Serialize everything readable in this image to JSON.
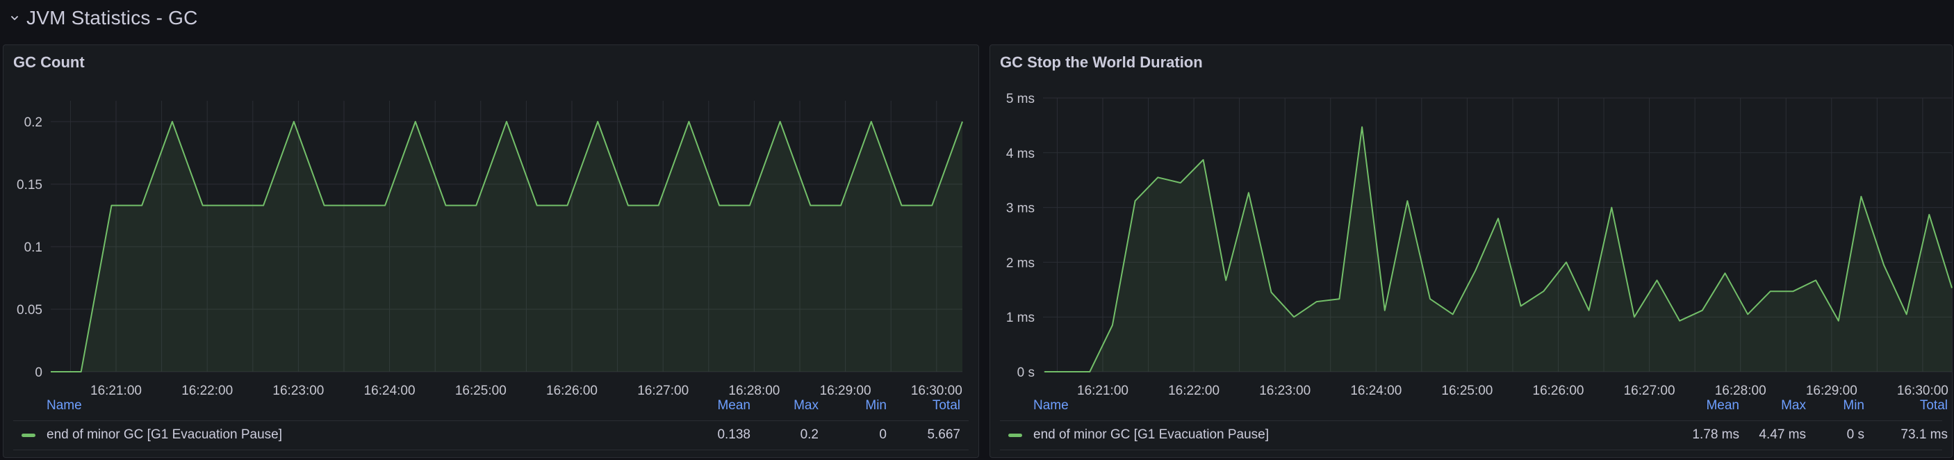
{
  "row": {
    "title": "JVM Statistics - GC"
  },
  "colors": {
    "series": "#73bf69",
    "grid": "#2b2e35",
    "axis_text": "#c7c7d1",
    "legend_header": "#6e9fff"
  },
  "legend_headers": {
    "name": "Name",
    "mean": "Mean",
    "max": "Max",
    "min": "Min",
    "total": "Total"
  },
  "panels": [
    {
      "title": "GC Count",
      "legend": {
        "name": "end of minor GC [G1 Evacuation Pause]",
        "mean": "0.138",
        "max": "0.2",
        "min": "0",
        "total": "5.667"
      },
      "chart_data": {
        "type": "area",
        "ylim": [
          0,
          0.2
        ],
        "yticks": [
          0,
          0.05,
          0.1,
          0.15,
          0.2
        ],
        "ytick_labels": [
          "0",
          "0.05",
          "0.1",
          "0.15",
          "0.2"
        ],
        "xtick_labels": [
          "16:21:00",
          "16:22:00",
          "16:23:00",
          "16:24:00",
          "16:25:00",
          "16:26:00",
          "16:27:00",
          "16:28:00",
          "16:29:00",
          "16:30:00"
        ],
        "x_minutes": [
          -0.75,
          -0.25,
          0,
          0.75,
          1,
          1.5,
          1.75,
          2.5,
          3,
          3.75,
          4,
          4.5,
          5,
          5.25,
          5.75,
          6,
          6.5,
          7,
          7.25,
          7.75,
          8,
          8.5,
          9,
          9.25,
          9.75,
          10,
          10.5,
          11,
          11.25,
          11.75,
          12,
          12.25
        ],
        "series": [
          {
            "name": "end of minor GC [G1 Evacuation Pause]",
            "x": [
              "16:20:30",
              "16:20:45",
              "16:21:00",
              "16:21:45",
              "16:22:00",
              "16:22:15",
              "16:23:00",
              "16:23:30",
              "16:23:45",
              "16:24:00",
              "16:24:15",
              "16:25:00",
              "16:25:15",
              "16:25:30",
              "16:26:00",
              "16:26:15",
              "16:26:30",
              "16:27:00",
              "16:27:15",
              "16:27:30",
              "16:27:45",
              "16:28:00",
              "16:28:30",
              "16:28:45",
              "16:29:00",
              "16:29:15",
              "16:29:30",
              "16:29:45",
              "16:30:00",
              "16:30:15"
            ],
            "values": [
              0,
              0,
              0.133,
              0.133,
              0.2,
              0.133,
              0.133,
              0.133,
              0.2,
              0.133,
              0.133,
              0.133,
              0.2,
              0.133,
              0.133,
              0.2,
              0.133,
              0.133,
              0.2,
              0.133,
              0.133,
              0.2,
              0.133,
              0.133,
              0.2,
              0.133,
              0.133,
              0.2,
              0.133,
              0.133,
              0.2
            ]
          }
        ]
      }
    },
    {
      "title": "GC Stop the World Duration",
      "legend": {
        "name": "end of minor GC [G1 Evacuation Pause]",
        "mean": "1.78 ms",
        "max": "4.47 ms",
        "min": "0 s",
        "total": "73.1 ms"
      },
      "chart_data": {
        "type": "area",
        "ylim": [
          0,
          5
        ],
        "yticks": [
          0,
          1,
          2,
          3,
          4,
          5
        ],
        "ytick_labels": [
          "0 s",
          "1 ms",
          "2 ms",
          "3 ms",
          "4 ms",
          "5 ms"
        ],
        "xtick_labels": [
          "16:21:00",
          "16:22:00",
          "16:23:00",
          "16:24:00",
          "16:25:00",
          "16:26:00",
          "16:27:00",
          "16:28:00",
          "16:29:00",
          "16:30:00"
        ],
        "series": [
          {
            "name": "end of minor GC [G1 Evacuation Pause]",
            "values": [
              0,
              0,
              0,
              0.85,
              3.12,
              3.55,
              3.45,
              3.87,
              1.67,
              3.27,
              1.45,
              1.0,
              1.28,
              1.33,
              4.47,
              1.12,
              3.12,
              1.33,
              1.05,
              1.85,
              2.8,
              1.2,
              1.47,
              2.0,
              1.12,
              3.0,
              1.0,
              1.67,
              0.93,
              1.12,
              1.8,
              1.05,
              1.47,
              1.47,
              1.67,
              0.93,
              3.2,
              1.95,
              1.05,
              2.87,
              1.53
            ]
          }
        ]
      }
    }
  ]
}
